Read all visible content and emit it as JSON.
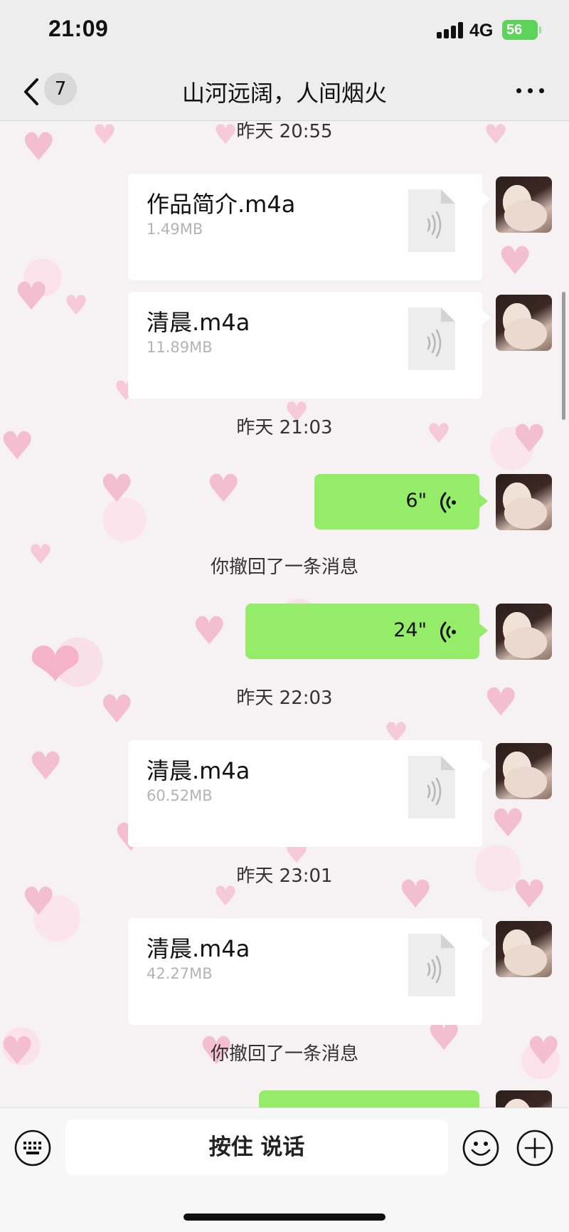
{
  "status_bar": {
    "time": "21:09",
    "network": "4G",
    "battery": "56"
  },
  "nav": {
    "unread_count": "7",
    "title": "山河远阔，人间烟火"
  },
  "messages": {
    "ts1": "昨天 20:55",
    "file1": {
      "name": "作品简介.m4a",
      "size": "1.49MB"
    },
    "file2": {
      "name": "清晨.m4a",
      "size": "11.89MB"
    },
    "ts2": "昨天 21:03",
    "voice1": {
      "duration": "6\""
    },
    "recall1": "你撤回了一条消息",
    "voice2": {
      "duration": "24\""
    },
    "ts3": "昨天 22:03",
    "file3": {
      "name": "清晨.m4a",
      "size": "60.52MB"
    },
    "ts4": "昨天 23:01",
    "file4": {
      "name": "清晨.m4a",
      "size": "42.27MB"
    },
    "recall2": "你撤回了一条消息"
  },
  "input_bar": {
    "talk_label": "按住 说话"
  },
  "colors": {
    "voice_bubble": "#95ec69",
    "battery": "#5dd35b",
    "bar_background": "#ededed"
  },
  "icons": [
    "back-icon",
    "more-icon",
    "audio-file-icon",
    "voice-wave-icon",
    "keyboard-icon",
    "emoji-icon",
    "plus-icon"
  ]
}
